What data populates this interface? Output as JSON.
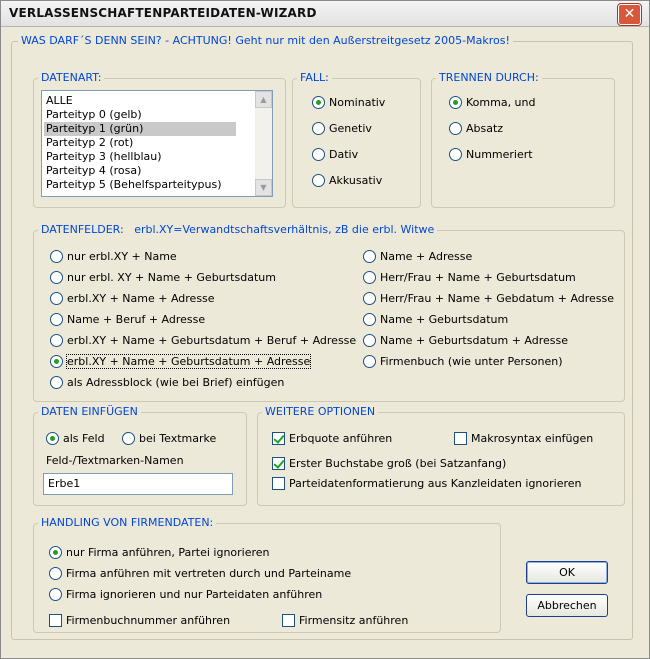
{
  "window": {
    "title": "VERLASSENSCHAFTENPARTEIDATEN-WIZARD",
    "close": "✕"
  },
  "outer_group": {
    "legend": "WAS DARF´S DENN SEIN? - ACHTUNG! Geht nur mit den Außerstreitgesetz 2005-Makros!"
  },
  "datenart": {
    "legend": "DATENART:",
    "items": [
      "ALLE",
      "Parteityp 0 (gelb)",
      "Parteityp 1 (grün)",
      "Parteityp 2 (rot)",
      "Parteityp 3 (hellblau)",
      "Parteityp 4 (rosa)",
      "Parteityp 5 (Behelfsparteitypus)"
    ],
    "selected": "Parteityp 1 (grün)"
  },
  "fall": {
    "legend": "FALL:",
    "options": [
      "Nominativ",
      "Genetiv",
      "Dativ",
      "Akkusativ"
    ],
    "selected": "Nominativ"
  },
  "trennen": {
    "legend": "TRENNEN DURCH:",
    "options": [
      "Komma, und",
      "Absatz",
      "Nummeriert"
    ],
    "selected": "Komma, und"
  },
  "datenfelder": {
    "legend": "DATENFELDER:",
    "hint": "erbl.XY=Verwandtschaftsverhältnis, zB die erbl. Witwe",
    "left": [
      "nur erbl.XY + Name",
      "nur erbl. XY + Name + Geburtsdatum",
      "erbl.XY + Name + Adresse",
      "Name + Beruf + Adresse",
      "erbl.XY + Name + Geburtsdatum + Beruf + Adresse",
      "erbl.XY + Name + Geburtsdatum + Adresse",
      "als Adressblock (wie bei Brief) einfügen"
    ],
    "right": [
      "Name + Adresse",
      "Herr/Frau + Name + Geburtsdatum",
      "Herr/Frau + Name + Gebdatum + Adresse",
      "Name + Geburtsdatum",
      "Name + Geburtsdatum + Adresse",
      "Firmenbuch (wie unter Personen)"
    ],
    "selected": "erbl.XY + Name + Geburtsdatum + Adresse"
  },
  "daten_einfuegen": {
    "legend": "DATEN EINFÜGEN",
    "option_feld": "als Feld",
    "option_textmarke": "bei Textmarke",
    "selected": "als Feld",
    "name_label": "Feld-/Textmarken-Namen",
    "name_value": "Erbe1"
  },
  "weitere_optionen": {
    "legend": "WEITERE OPTIONEN",
    "erbquote": {
      "label": "Erbquote anführen",
      "checked": true
    },
    "makrosyntax": {
      "label": "Makrosyntax einfügen",
      "checked": false
    },
    "erster_buchstabe": {
      "label": "Erster Buchstabe groß (bei Satzanfang)",
      "checked": true
    },
    "parteidatenformat": {
      "label": "Parteidatenformatierung aus Kanzleidaten ignorieren",
      "checked": false
    }
  },
  "firmendaten": {
    "legend": "HANDLING VON FIRMENDATEN:",
    "options": [
      "nur Firma anführen, Partei ignorieren",
      "Firma anführen mit vertreten durch und Parteiname",
      "Firma ignorieren und nur Parteidaten anführen"
    ],
    "selected": "nur Firma anführen, Partei ignorieren",
    "firmenbuchnummer": {
      "label": "Firmenbuchnummer anführen",
      "checked": false
    },
    "firmensitz": {
      "label": "Firmensitz anführen",
      "checked": false
    }
  },
  "buttons": {
    "ok": "OK",
    "cancel": "Abbrechen"
  },
  "colors": {
    "legend_blue": "#0046d5",
    "dialog_bg": "#ece9d8",
    "close_red": "#d9573a",
    "radio_green": "#21a121"
  }
}
